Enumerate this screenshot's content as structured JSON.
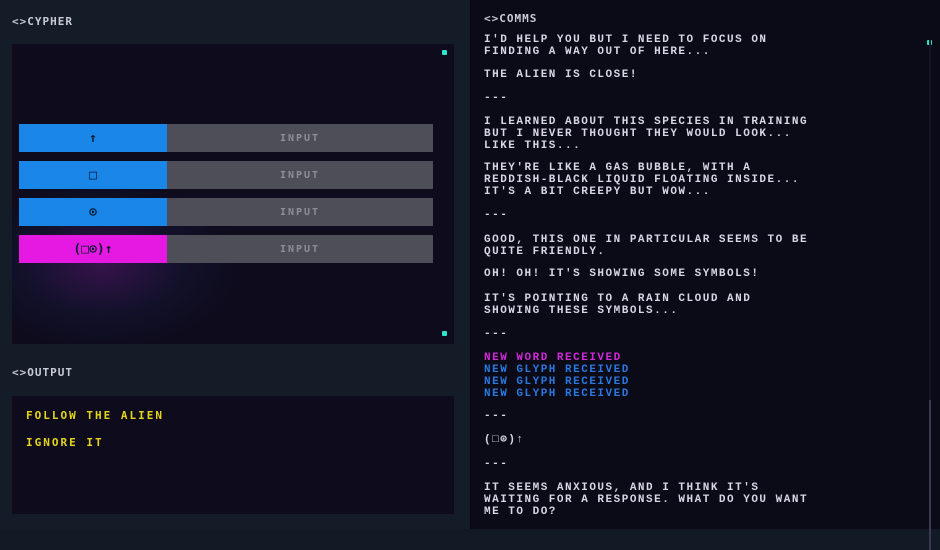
{
  "cypher": {
    "title": "<>CYPHER",
    "rows": [
      {
        "glyph": "↑",
        "glyph_color": "#1a86e8",
        "input_label": "INPUT"
      },
      {
        "glyph": "□",
        "glyph_color": "#1a86e8",
        "input_label": "INPUT"
      },
      {
        "glyph": "⊙",
        "glyph_color": "#1a86e8",
        "input_label": "INPUT"
      },
      {
        "glyph": "(□⊙)↑",
        "glyph_color": "#e619e3",
        "input_label": "INPUT"
      }
    ]
  },
  "output": {
    "title": "<>OUTPUT",
    "options": [
      "FOLLOW THE ALIEN",
      "IGNORE IT"
    ]
  },
  "comms": {
    "title": "<>COMMS",
    "messages": [
      {
        "text": "I'D HELP YOU BUT I NEED TO FOCUS ON\nFINDING A WAY OUT OF HERE...",
        "color": "#d9d6e6"
      },
      {
        "text": "THE ALIEN IS CLOSE!",
        "color": "#d9d6e6"
      },
      {
        "text": "---",
        "color": "#d9d6e6"
      },
      {
        "text": "I LEARNED ABOUT THIS SPECIES IN TRAINING\nBUT I NEVER THOUGHT THEY WOULD LOOK...\nLIKE THIS...",
        "color": "#d9d6e6"
      },
      {
        "text": "THEY'RE LIKE A GAS BUBBLE, WITH A\nREDDISH-BLACK LIQUID FLOATING INSIDE...\nIT'S A BIT CREEPY BUT WOW...",
        "color": "#d9d6e6"
      },
      {
        "text": "---",
        "color": "#d9d6e6"
      },
      {
        "text": "GOOD, THIS ONE IN PARTICULAR SEEMS TO BE\nQUITE FRIENDLY.",
        "color": "#d9d6e6"
      },
      {
        "text": "OH! OH! IT'S SHOWING SOME SYMBOLS!",
        "color": "#d9d6e6"
      },
      {
        "text": "IT'S POINTING TO A RAIN CLOUD AND\nSHOWING THESE SYMBOLS...",
        "color": "#d9d6e6"
      },
      {
        "text": "---",
        "color": "#d9d6e6"
      },
      {
        "text": "NEW WORD RECEIVED",
        "color": "#d12ad8"
      },
      {
        "text": "NEW GLYPH RECEIVED",
        "color": "#2a78e0"
      },
      {
        "text": "NEW GLYPH RECEIVED",
        "color": "#2a78e0"
      },
      {
        "text": "NEW GLYPH RECEIVED",
        "color": "#2a78e0"
      },
      {
        "text": "---",
        "color": "#d9d6e6"
      },
      {
        "text": "(□⊙)↑",
        "color": "#d9d6e6"
      },
      {
        "text": "---",
        "color": "#d9d6e6"
      },
      {
        "text": "IT SEEMS ANXIOUS, AND I THINK IT'S\nWAITING FOR A RESPONSE. WHAT DO YOU WANT\nME TO DO?",
        "color": "#d9d6e6"
      }
    ]
  },
  "accent_colors": {
    "teal": "#2ee6c8",
    "blue": "#1a86e8",
    "magenta": "#e619e3",
    "yellow": "#e5d61c"
  }
}
